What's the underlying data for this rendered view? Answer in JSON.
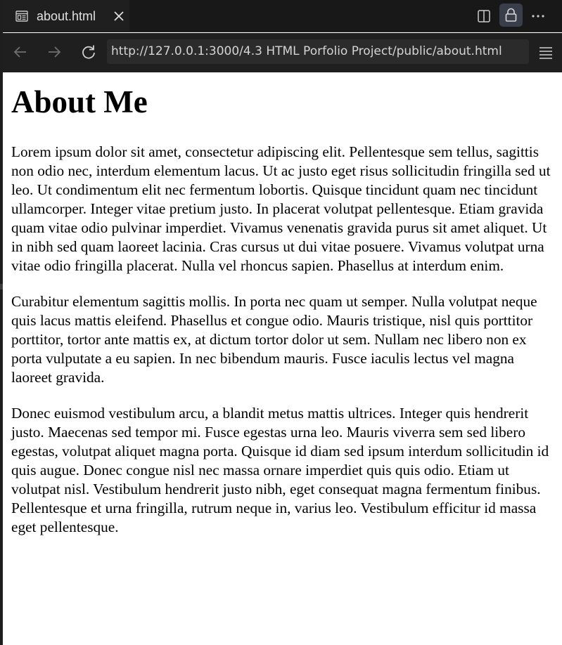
{
  "browser": {
    "tab": {
      "title": "about.html",
      "icon": "preview-page-icon",
      "close_icon": "close-icon"
    },
    "toolbar_icons": [
      "split-editor-icon",
      "lock-icon",
      "more-actions-icon"
    ],
    "nav": {
      "back_icon": "arrow-left-icon",
      "forward_icon": "arrow-right-icon",
      "reload_icon": "reload-icon",
      "url": "http://127.0.0.1:3000/4.3 HTML Porfolio Project/public/about.html",
      "menu_icon": "hamburger-menu-icon"
    },
    "colors": {
      "chrome_dark": "#181818",
      "nav_bar": "#1f1f1f",
      "url_field": "#2b2b2b",
      "lock_button_bg": "#3a3d4a",
      "page_bg": "#ffffff"
    }
  },
  "page": {
    "heading": "About Me",
    "paragraphs": [
      "Lorem ipsum dolor sit amet, consectetur adipiscing elit. Pellentesque sem tellus, sagittis non odio nec, interdum elementum lacus. Ut ac justo eget risus sollicitudin fringilla sed ut leo. Ut condimentum elit nec fermentum lobortis. Quisque tincidunt quam nec tincidunt ullamcorper. Integer vitae pretium justo. In placerat volutpat pellentesque. Etiam gravida quam vitae odio pulvinar imperdiet. Vivamus venenatis gravida purus sit amet aliquet. Ut in nibh sed quam laoreet lacinia. Cras cursus ut dui vitae posuere. Vivamus volutpat urna vitae odio fringilla placerat. Nulla vel rhoncus sapien. Phasellus at interdum enim.",
      "Curabitur elementum sagittis mollis. In porta nec quam ut semper. Nulla volutpat neque quis lacus mattis eleifend. Phasellus et congue odio. Mauris tristique, nisl quis porttitor porttitor, tortor ante mattis ex, at dictum tortor dolor ut sem. Nullam nec libero non ex porta vulputate a eu sapien. In nec bibendum mauris. Fusce iaculis lectus vel magna laoreet gravida.",
      "Donec euismod vestibulum arcu, a blandit metus mattis ultrices. Integer quis hendrerit justo. Maecenas sed tempor mi. Fusce egestas urna leo. Mauris viverra sem sed libero egestas, volutpat aliquet magna porta. Quisque id diam sed ipsum interdum sollicitudin id quis augue. Donec congue nisl nec massa ornare imperdiet quis quis odio. Etiam ut volutpat nisl. Vestibulum hendrerit justo nibh, eget consequat magna fermentum finibus. Pellentesque et urna fringilla, rutrum neque in, varius leo. Vestibulum efficitur id massa eget pellentesque."
    ]
  }
}
